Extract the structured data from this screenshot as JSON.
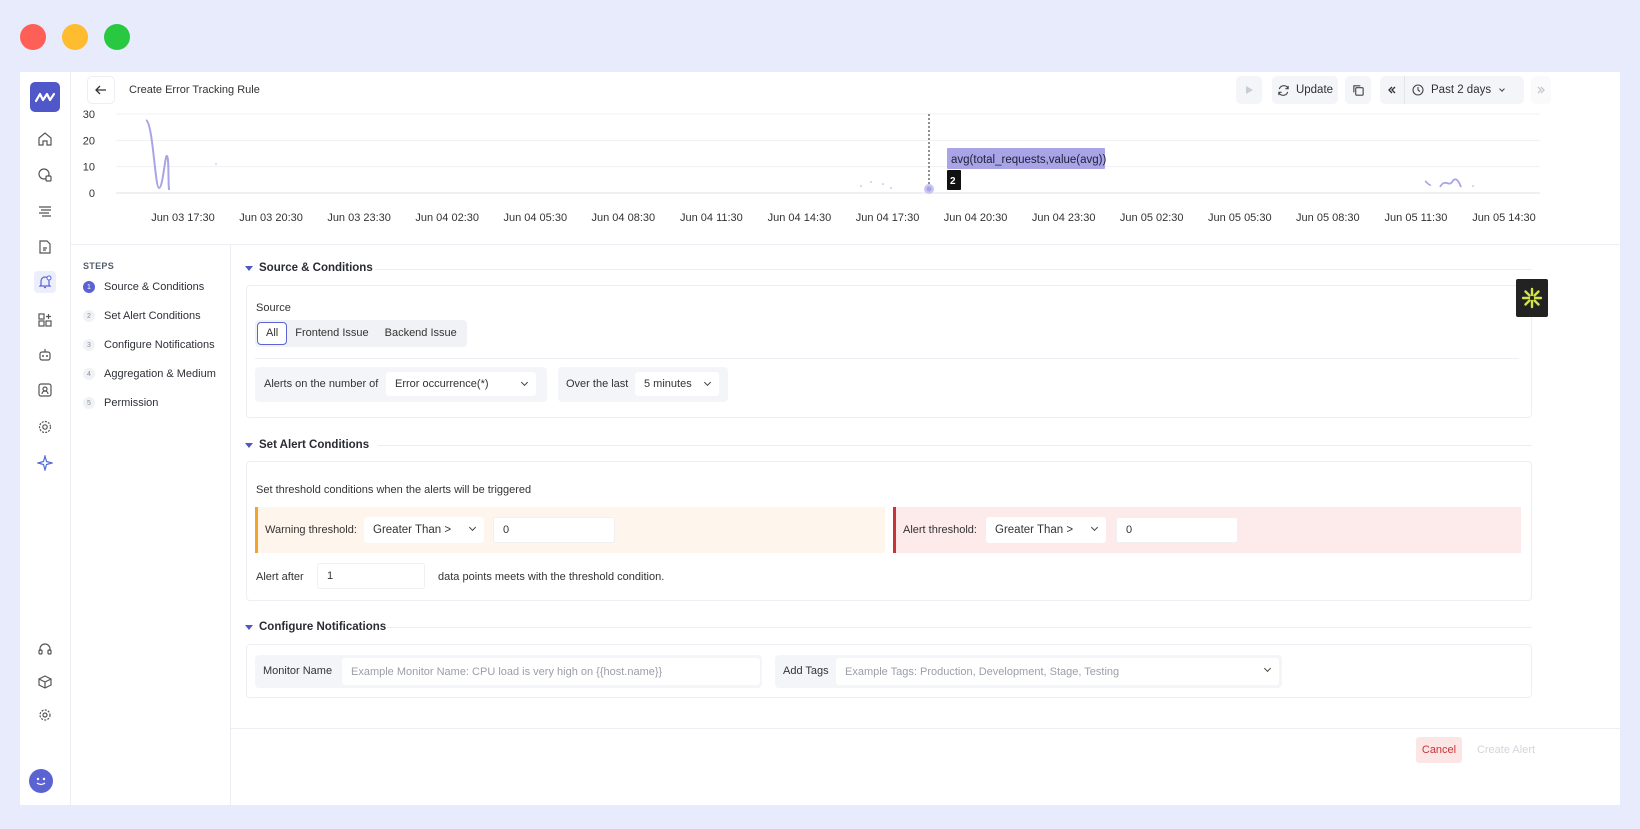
{
  "window": {
    "controls": [
      "close",
      "minimize",
      "maximize"
    ],
    "colors": {
      "close": "#fe5f57",
      "minimize": "#febc2e",
      "maximize": "#28c840"
    }
  },
  "colors": {
    "accent": "#5b63d3",
    "warning": "#f2a52b",
    "alert": "#c9343a",
    "series": "#a8a4e6"
  },
  "sidebar": {
    "items": [
      {
        "icon": "home-icon"
      },
      {
        "icon": "apm-icon"
      },
      {
        "icon": "logs-icon"
      },
      {
        "icon": "reports-icon"
      },
      {
        "icon": "alerts-icon",
        "active": true
      },
      {
        "icon": "dashboard-builder-icon"
      },
      {
        "icon": "bot-icon"
      },
      {
        "icon": "user-monitoring-icon"
      },
      {
        "icon": "gear-circle-icon"
      },
      {
        "icon": "sparkle-icon"
      }
    ],
    "bottom": [
      {
        "icon": "headset-icon"
      },
      {
        "icon": "package-icon"
      },
      {
        "icon": "settings-icon"
      }
    ]
  },
  "topbar": {
    "title": "Create Error Tracking Rule",
    "update_label": "Update",
    "time_range": "Past 2 days"
  },
  "chart_data": {
    "type": "line",
    "y_ticks": [
      "30",
      "20",
      "10",
      "0"
    ],
    "ylim": [
      0,
      30
    ],
    "x_ticks": [
      "Jun 03 17:30",
      "Jun 03 20:30",
      "Jun 03 23:30",
      "Jun 04 02:30",
      "Jun 04 05:30",
      "Jun 04 08:30",
      "Jun 04 11:30",
      "Jun 04 14:30",
      "Jun 04 17:30",
      "Jun 04 20:30",
      "Jun 04 23:30",
      "Jun 05 02:30",
      "Jun 05 05:30",
      "Jun 05 08:30",
      "Jun 05 11:30",
      "Jun 05 14:30"
    ],
    "series": [
      {
        "name": "avg(total_requests,value(avg))"
      }
    ],
    "tooltip": {
      "label": "avg(total_requests,value(avg))",
      "value": "2"
    },
    "grid": true
  },
  "steps": {
    "title": "STEPS",
    "items": [
      {
        "num": "1",
        "label": "Source & Conditions",
        "active": true
      },
      {
        "num": "2",
        "label": "Set Alert Conditions"
      },
      {
        "num": "3",
        "label": "Configure Notifications"
      },
      {
        "num": "4",
        "label": "Aggregation & Medium"
      },
      {
        "num": "5",
        "label": "Permission"
      }
    ]
  },
  "source_conditions": {
    "header": "Source & Conditions",
    "source_label": "Source",
    "source_options": [
      "All",
      "Frontend Issue",
      "Backend Issue"
    ],
    "source_selected": "All",
    "alerts_on_label": "Alerts on the number of",
    "alerts_on_value": "Error occurrence(*)",
    "over_last_label": "Over the last",
    "over_last_value": "5 minutes"
  },
  "alert_conditions": {
    "header": "Set Alert Conditions",
    "description": "Set threshold conditions when the alerts will be triggered",
    "warning_label": "Warning threshold:",
    "warning_operator": "Greater Than >",
    "warning_value": "0",
    "alert_label": "Alert threshold:",
    "alert_operator": "Greater Than >",
    "alert_value": "0",
    "alert_after_label": "Alert after",
    "alert_after_value": "1",
    "data_points_text": "data points meets with the threshold condition."
  },
  "notifications": {
    "header": "Configure Notifications",
    "monitor_name_label": "Monitor Name",
    "monitor_name_placeholder": "Example Monitor Name: CPU load is very high on {{host.name}}",
    "tags_label": "Add Tags",
    "tags_placeholder": "Example Tags: Production, Development, Stage, Testing"
  },
  "footer": {
    "cancel_label": "Cancel",
    "create_label": "Create Alert"
  }
}
